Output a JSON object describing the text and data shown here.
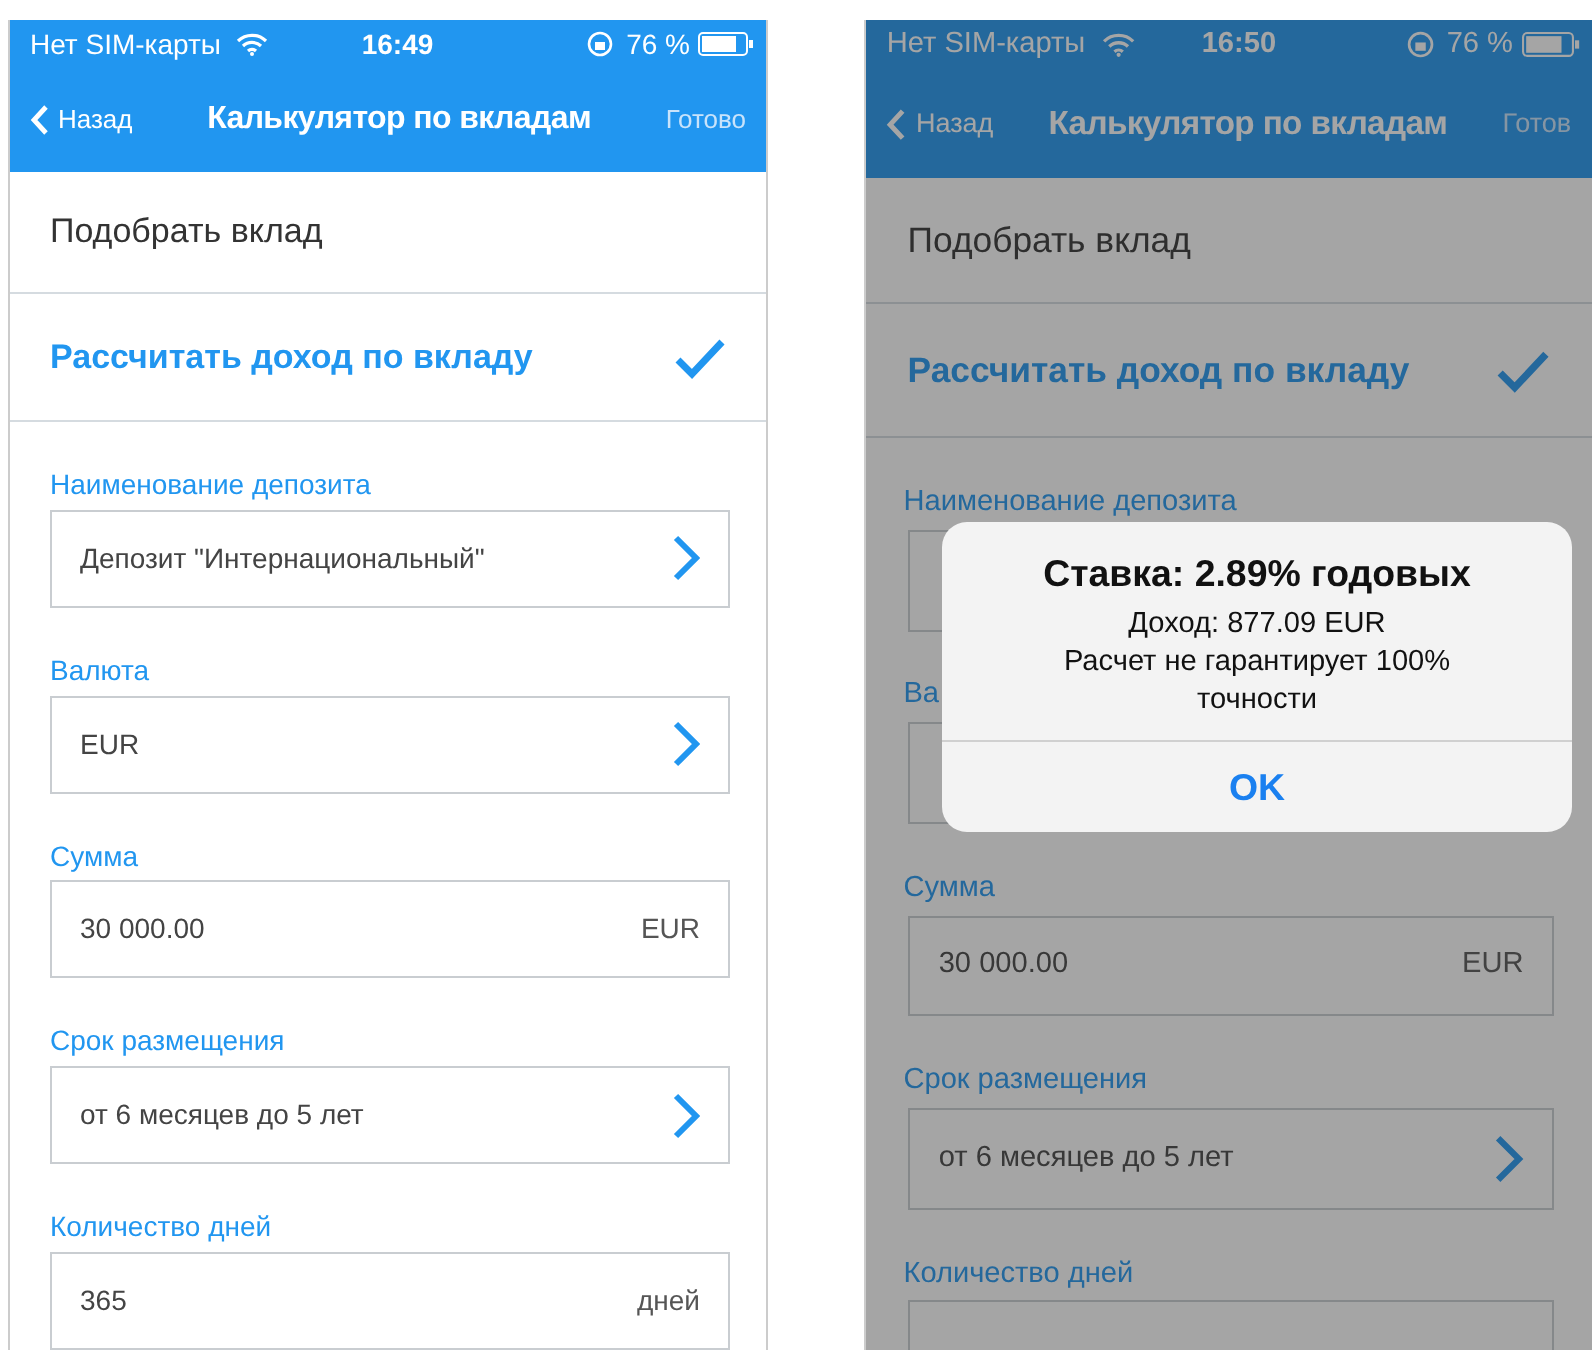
{
  "screens": [
    {
      "dimmed": false,
      "status": {
        "carrier": "Нет SIM-карты",
        "time": "16:49",
        "battery": "76 %"
      },
      "nav": {
        "back": "Назад",
        "title": "Калькулятор по вкладам",
        "action": "Готово"
      },
      "modes": [
        {
          "label": "Подобрать вклад",
          "selected": false
        },
        {
          "label": "Рассчитать доход по вкладу",
          "selected": true
        }
      ],
      "fields": [
        {
          "kind": "select",
          "label": "Наименование депозита",
          "value": "Депозит \"Интернациональный\""
        },
        {
          "kind": "select",
          "label": "Валюта",
          "value": "EUR"
        },
        {
          "kind": "input",
          "label": "Сумма",
          "value": "30 000.00",
          "suffix": "EUR"
        },
        {
          "kind": "select",
          "label": "Срок размещения",
          "value": "от 6 месяцев до 5 лет"
        },
        {
          "kind": "input",
          "label": "Количество дней",
          "value": "365",
          "suffix": "дней"
        }
      ]
    },
    {
      "dimmed": true,
      "status": {
        "carrier": "Нет SIM-карты",
        "time": "16:50",
        "battery": "76 %"
      },
      "nav": {
        "back": "Назад",
        "title": "Калькулятор по вкладам",
        "action": "Готов"
      },
      "modes": [
        {
          "label": "Подобрать вклад",
          "selected": false
        },
        {
          "label": "Рассчитать доход по вкладу",
          "selected": true
        }
      ],
      "fields": [
        {
          "kind": "select",
          "label": "Наименование депозита"
        },
        {
          "kind": "select",
          "label": "Ва"
        },
        {
          "kind": "input",
          "label": "Сумма",
          "value": "30 000.00",
          "suffix": "EUR"
        },
        {
          "kind": "select",
          "label": "Срок размещения",
          "value": "от 6 месяцев до 5 лет"
        },
        {
          "kind": "input",
          "label": "Количество дней"
        }
      ],
      "alert": {
        "title": "Ставка: 2.89% годовых",
        "lines": [
          "Доход: 877.09 EUR",
          "Расчет не гарантирует 100% точности"
        ],
        "button": "OK"
      }
    }
  ]
}
